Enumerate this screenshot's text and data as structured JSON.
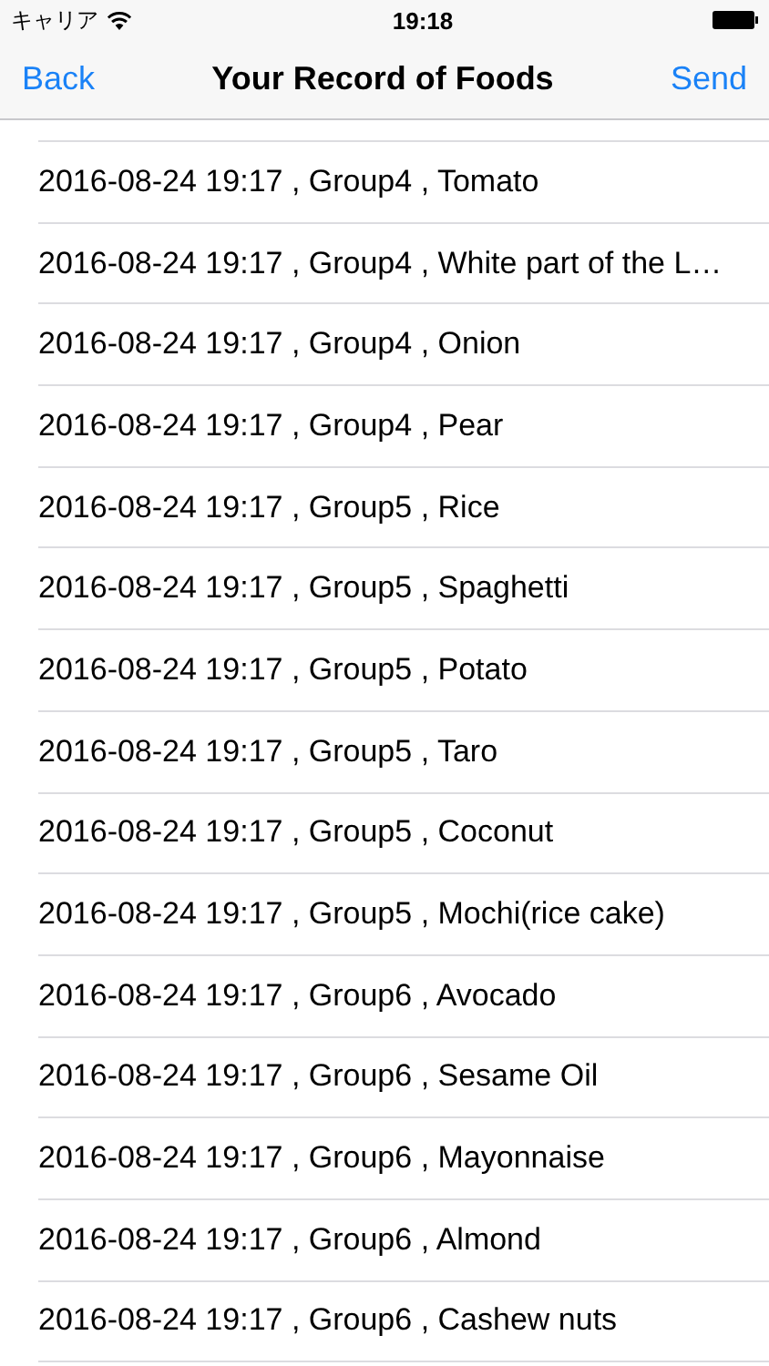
{
  "status_bar": {
    "carrier": "キャリア",
    "time": "19:18"
  },
  "nav": {
    "back": "Back",
    "title": "Your Record of Foods",
    "action": "Send"
  },
  "rows": [
    "2016-08-24 19:17 , Group4 , Tomato",
    "2016-08-24 19:17 , Group4 , White part of the L…",
    "2016-08-24 19:17 , Group4 , Onion",
    "2016-08-24 19:17 , Group4 , Pear",
    "2016-08-24 19:17 , Group5 , Rice",
    "2016-08-24 19:17 , Group5 , Spaghetti",
    "2016-08-24 19:17 , Group5 , Potato",
    "2016-08-24 19:17 , Group5 , Taro",
    "2016-08-24 19:17 , Group5 , Coconut",
    "2016-08-24 19:17 , Group5 , Mochi(rice cake)",
    "2016-08-24 19:17 , Group6 , Avocado",
    "2016-08-24 19:17 , Group6 , Sesame Oil",
    "2016-08-24 19:17 , Group6 , Mayonnaise",
    "2016-08-24 19:17 , Group6 , Almond",
    "2016-08-24 19:17 , Group6 , Cashew nuts"
  ]
}
